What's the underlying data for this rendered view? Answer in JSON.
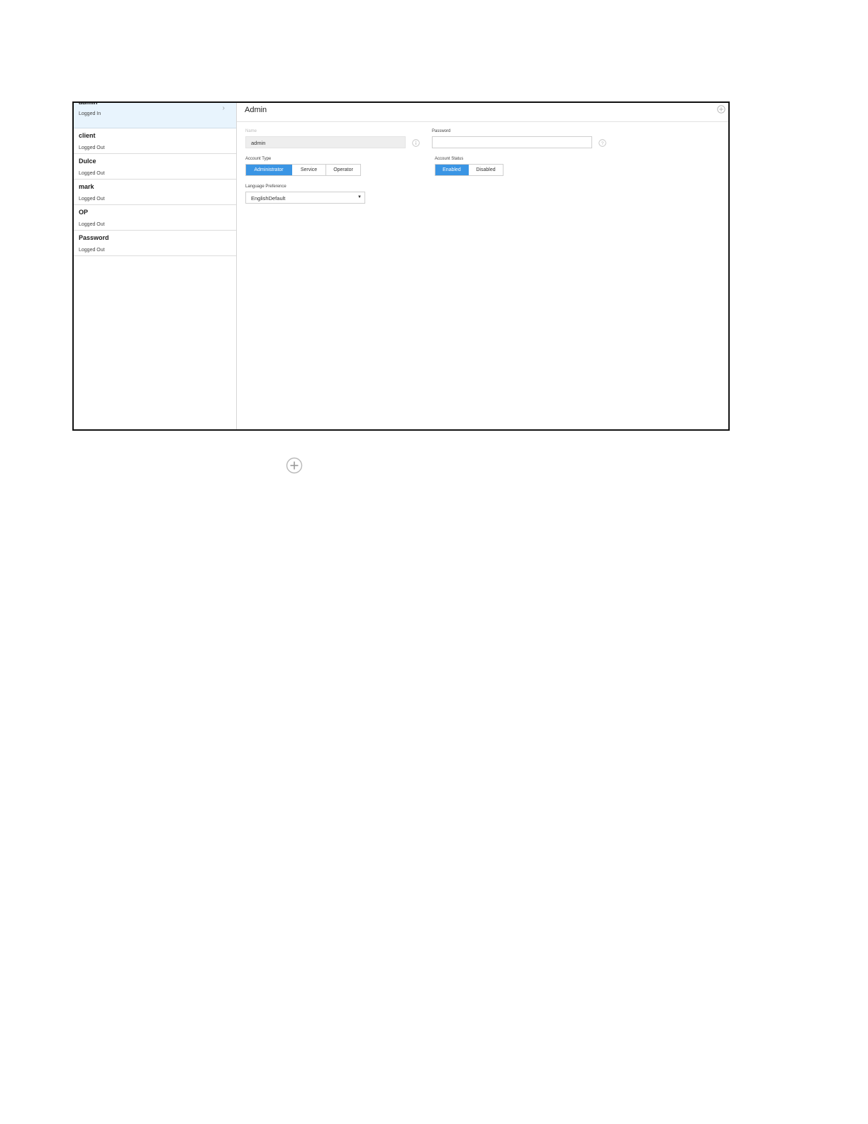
{
  "users": [
    {
      "name": "admin",
      "status": "Logged In",
      "selected": true
    },
    {
      "name": "client",
      "status": "Logged Out"
    },
    {
      "name": "Dulce",
      "status": "Logged Out"
    },
    {
      "name": "mark",
      "status": "Logged Out"
    },
    {
      "name": "OP",
      "status": "Logged Out"
    },
    {
      "name": "Password",
      "status": "Logged Out"
    }
  ],
  "detail": {
    "title": "Admin",
    "name_label": "Name",
    "name_value": "admin",
    "password_label": "Password",
    "password_value": "",
    "account_type_label": "Account Type",
    "account_types": [
      "Administrator",
      "Service",
      "Operator"
    ],
    "account_type_selected": "Administrator",
    "account_status_label": "Account Status",
    "account_statuses": [
      "Enabled",
      "Disabled"
    ],
    "account_status_selected": "Enabled",
    "language_label": "Language Preference",
    "language_value": "EnglishDefault"
  },
  "icons": {
    "add": "plus-circle-icon",
    "info": "info-icon",
    "help": "question-icon",
    "chevron": "chevron-right-icon",
    "dropdown": "caret-down-icon"
  },
  "colors": {
    "accent": "#3a95e4",
    "selected_row": "#e8f4fd"
  }
}
